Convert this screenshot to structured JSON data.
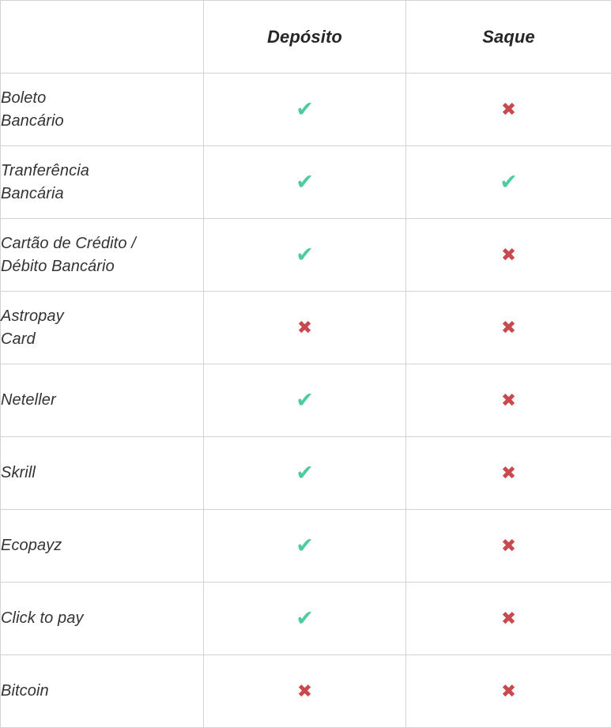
{
  "table": {
    "columns": [
      {
        "key": "method",
        "label": ""
      },
      {
        "key": "deposit",
        "label": "Depósito"
      },
      {
        "key": "withdraw",
        "label": "Saque"
      }
    ],
    "marks": {
      "yes_glyph": "✔",
      "no_glyph": "✖",
      "yes_name": "check-icon",
      "no_name": "cross-icon"
    },
    "colors": {
      "yes": "#4ecba0",
      "no": "#c9494e",
      "grid": "#ced4d7",
      "cell_background": "#ffffff",
      "header_text": "#262626",
      "body_text": "#333333"
    },
    "rows": [
      {
        "method_lines": [
          "Boleto",
          "Bancário"
        ],
        "deposit": "✔",
        "withdraw": "✖"
      },
      {
        "method_lines": [
          "Tranferência",
          "Bancária"
        ],
        "deposit": "✔",
        "withdraw": "✔"
      },
      {
        "method_lines": [
          "Cartão de Crédito /",
          "Débito Bancário"
        ],
        "deposit": "✔",
        "withdraw": "✖"
      },
      {
        "method_lines": [
          "Astropay",
          "Card"
        ],
        "deposit": "✖",
        "withdraw": "✖"
      },
      {
        "method_lines": [
          "Neteller"
        ],
        "deposit": "✔",
        "withdraw": "✖"
      },
      {
        "method_lines": [
          "Skrill"
        ],
        "deposit": "✔",
        "withdraw": "✖"
      },
      {
        "method_lines": [
          "Ecopayz"
        ],
        "deposit": "✔",
        "withdraw": "✖"
      },
      {
        "method_lines": [
          "Click to pay"
        ],
        "deposit": "✔",
        "withdraw": "✖"
      },
      {
        "method_lines": [
          "Bitcoin"
        ],
        "deposit": "✖",
        "withdraw": "✖"
      }
    ]
  }
}
